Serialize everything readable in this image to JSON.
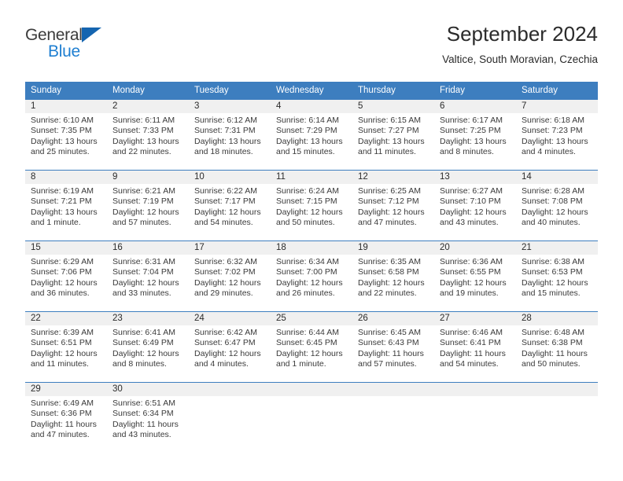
{
  "brand": {
    "name_part1": "General",
    "name_part2": "Blue",
    "triangle_icon": "triangle-icon",
    "color_dark": "#3b3b3b",
    "color_blue": "#1f7fd1"
  },
  "header": {
    "title": "September 2024",
    "subtitle": "Valtice, South Moravian, Czechia"
  },
  "theme": {
    "header_blue": "#3d7ebf",
    "daynum_gray": "#f0f0f0",
    "text_dark": "#2b2b2b"
  },
  "weekdays": [
    "Sunday",
    "Monday",
    "Tuesday",
    "Wednesday",
    "Thursday",
    "Friday",
    "Saturday"
  ],
  "labels": {
    "sunrise": "Sunrise:",
    "sunset": "Sunset:",
    "daylight": "Daylight:"
  },
  "weeks": [
    [
      {
        "day": "1",
        "sunrise": "Sunrise: 6:10 AM",
        "sunset": "Sunset: 7:35 PM",
        "daylight1": "Daylight: 13 hours",
        "daylight2": "and 25 minutes."
      },
      {
        "day": "2",
        "sunrise": "Sunrise: 6:11 AM",
        "sunset": "Sunset: 7:33 PM",
        "daylight1": "Daylight: 13 hours",
        "daylight2": "and 22 minutes."
      },
      {
        "day": "3",
        "sunrise": "Sunrise: 6:12 AM",
        "sunset": "Sunset: 7:31 PM",
        "daylight1": "Daylight: 13 hours",
        "daylight2": "and 18 minutes."
      },
      {
        "day": "4",
        "sunrise": "Sunrise: 6:14 AM",
        "sunset": "Sunset: 7:29 PM",
        "daylight1": "Daylight: 13 hours",
        "daylight2": "and 15 minutes."
      },
      {
        "day": "5",
        "sunrise": "Sunrise: 6:15 AM",
        "sunset": "Sunset: 7:27 PM",
        "daylight1": "Daylight: 13 hours",
        "daylight2": "and 11 minutes."
      },
      {
        "day": "6",
        "sunrise": "Sunrise: 6:17 AM",
        "sunset": "Sunset: 7:25 PM",
        "daylight1": "Daylight: 13 hours",
        "daylight2": "and 8 minutes."
      },
      {
        "day": "7",
        "sunrise": "Sunrise: 6:18 AM",
        "sunset": "Sunset: 7:23 PM",
        "daylight1": "Daylight: 13 hours",
        "daylight2": "and 4 minutes."
      }
    ],
    [
      {
        "day": "8",
        "sunrise": "Sunrise: 6:19 AM",
        "sunset": "Sunset: 7:21 PM",
        "daylight1": "Daylight: 13 hours",
        "daylight2": "and 1 minute."
      },
      {
        "day": "9",
        "sunrise": "Sunrise: 6:21 AM",
        "sunset": "Sunset: 7:19 PM",
        "daylight1": "Daylight: 12 hours",
        "daylight2": "and 57 minutes."
      },
      {
        "day": "10",
        "sunrise": "Sunrise: 6:22 AM",
        "sunset": "Sunset: 7:17 PM",
        "daylight1": "Daylight: 12 hours",
        "daylight2": "and 54 minutes."
      },
      {
        "day": "11",
        "sunrise": "Sunrise: 6:24 AM",
        "sunset": "Sunset: 7:15 PM",
        "daylight1": "Daylight: 12 hours",
        "daylight2": "and 50 minutes."
      },
      {
        "day": "12",
        "sunrise": "Sunrise: 6:25 AM",
        "sunset": "Sunset: 7:12 PM",
        "daylight1": "Daylight: 12 hours",
        "daylight2": "and 47 minutes."
      },
      {
        "day": "13",
        "sunrise": "Sunrise: 6:27 AM",
        "sunset": "Sunset: 7:10 PM",
        "daylight1": "Daylight: 12 hours",
        "daylight2": "and 43 minutes."
      },
      {
        "day": "14",
        "sunrise": "Sunrise: 6:28 AM",
        "sunset": "Sunset: 7:08 PM",
        "daylight1": "Daylight: 12 hours",
        "daylight2": "and 40 minutes."
      }
    ],
    [
      {
        "day": "15",
        "sunrise": "Sunrise: 6:29 AM",
        "sunset": "Sunset: 7:06 PM",
        "daylight1": "Daylight: 12 hours",
        "daylight2": "and 36 minutes."
      },
      {
        "day": "16",
        "sunrise": "Sunrise: 6:31 AM",
        "sunset": "Sunset: 7:04 PM",
        "daylight1": "Daylight: 12 hours",
        "daylight2": "and 33 minutes."
      },
      {
        "day": "17",
        "sunrise": "Sunrise: 6:32 AM",
        "sunset": "Sunset: 7:02 PM",
        "daylight1": "Daylight: 12 hours",
        "daylight2": "and 29 minutes."
      },
      {
        "day": "18",
        "sunrise": "Sunrise: 6:34 AM",
        "sunset": "Sunset: 7:00 PM",
        "daylight1": "Daylight: 12 hours",
        "daylight2": "and 26 minutes."
      },
      {
        "day": "19",
        "sunrise": "Sunrise: 6:35 AM",
        "sunset": "Sunset: 6:58 PM",
        "daylight1": "Daylight: 12 hours",
        "daylight2": "and 22 minutes."
      },
      {
        "day": "20",
        "sunrise": "Sunrise: 6:36 AM",
        "sunset": "Sunset: 6:55 PM",
        "daylight1": "Daylight: 12 hours",
        "daylight2": "and 19 minutes."
      },
      {
        "day": "21",
        "sunrise": "Sunrise: 6:38 AM",
        "sunset": "Sunset: 6:53 PM",
        "daylight1": "Daylight: 12 hours",
        "daylight2": "and 15 minutes."
      }
    ],
    [
      {
        "day": "22",
        "sunrise": "Sunrise: 6:39 AM",
        "sunset": "Sunset: 6:51 PM",
        "daylight1": "Daylight: 12 hours",
        "daylight2": "and 11 minutes."
      },
      {
        "day": "23",
        "sunrise": "Sunrise: 6:41 AM",
        "sunset": "Sunset: 6:49 PM",
        "daylight1": "Daylight: 12 hours",
        "daylight2": "and 8 minutes."
      },
      {
        "day": "24",
        "sunrise": "Sunrise: 6:42 AM",
        "sunset": "Sunset: 6:47 PM",
        "daylight1": "Daylight: 12 hours",
        "daylight2": "and 4 minutes."
      },
      {
        "day": "25",
        "sunrise": "Sunrise: 6:44 AM",
        "sunset": "Sunset: 6:45 PM",
        "daylight1": "Daylight: 12 hours",
        "daylight2": "and 1 minute."
      },
      {
        "day": "26",
        "sunrise": "Sunrise: 6:45 AM",
        "sunset": "Sunset: 6:43 PM",
        "daylight1": "Daylight: 11 hours",
        "daylight2": "and 57 minutes."
      },
      {
        "day": "27",
        "sunrise": "Sunrise: 6:46 AM",
        "sunset": "Sunset: 6:41 PM",
        "daylight1": "Daylight: 11 hours",
        "daylight2": "and 54 minutes."
      },
      {
        "day": "28",
        "sunrise": "Sunrise: 6:48 AM",
        "sunset": "Sunset: 6:38 PM",
        "daylight1": "Daylight: 11 hours",
        "daylight2": "and 50 minutes."
      }
    ],
    [
      {
        "day": "29",
        "sunrise": "Sunrise: 6:49 AM",
        "sunset": "Sunset: 6:36 PM",
        "daylight1": "Daylight: 11 hours",
        "daylight2": "and 47 minutes."
      },
      {
        "day": "30",
        "sunrise": "Sunrise: 6:51 AM",
        "sunset": "Sunset: 6:34 PM",
        "daylight1": "Daylight: 11 hours",
        "daylight2": "and 43 minutes."
      },
      {
        "day": "",
        "sunrise": "",
        "sunset": "",
        "daylight1": "",
        "daylight2": ""
      },
      {
        "day": "",
        "sunrise": "",
        "sunset": "",
        "daylight1": "",
        "daylight2": ""
      },
      {
        "day": "",
        "sunrise": "",
        "sunset": "",
        "daylight1": "",
        "daylight2": ""
      },
      {
        "day": "",
        "sunrise": "",
        "sunset": "",
        "daylight1": "",
        "daylight2": ""
      },
      {
        "day": "",
        "sunrise": "",
        "sunset": "",
        "daylight1": "",
        "daylight2": ""
      }
    ]
  ]
}
